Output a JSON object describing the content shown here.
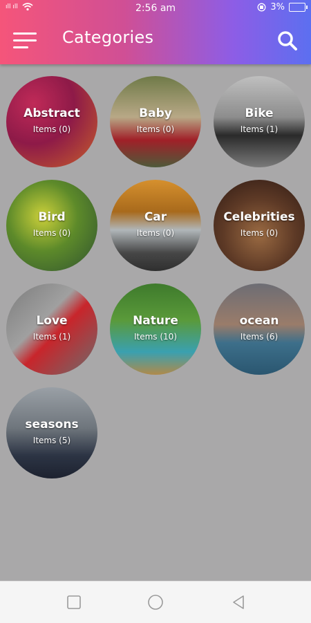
{
  "status_bar": {
    "time": "2:56 am",
    "battery": "3%",
    "signal_text": "ıll ıll"
  },
  "app_bar": {
    "title": "Categories"
  },
  "categories": [
    {
      "label": "Abstract",
      "count": "Items (0)"
    },
    {
      "label": "Baby",
      "count": "Items (0)"
    },
    {
      "label": "Bike",
      "count": "Items (1)"
    },
    {
      "label": "Bird",
      "count": "Items (0)"
    },
    {
      "label": "Car",
      "count": "Items (0)"
    },
    {
      "label": "Celebrities",
      "count": "Items (0)"
    },
    {
      "label": "Love",
      "count": "Items (1)"
    },
    {
      "label": "Nature",
      "count": "Items (10)"
    },
    {
      "label": "ocean",
      "count": "Items (6)"
    },
    {
      "label": "seasons",
      "count": "Items (5)"
    }
  ],
  "icons": [
    "menu-icon",
    "search-icon",
    "nav-square-icon",
    "nav-circle-icon",
    "nav-back-icon"
  ]
}
